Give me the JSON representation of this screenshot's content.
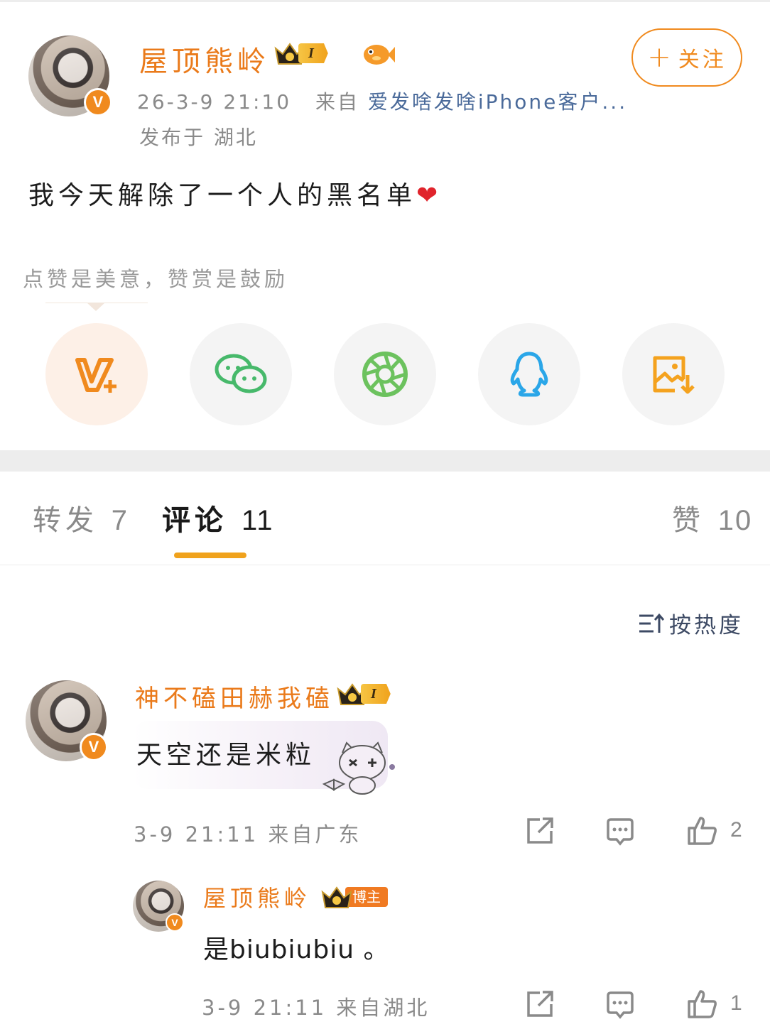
{
  "post": {
    "author_name": "屋顶熊岭",
    "member_level": "I",
    "timestamp": "26-3-9 21:10",
    "source_prefix": "来自",
    "source": "爱发啥发啥iPhone客户...",
    "location": "发布于 湖北",
    "follow_label": "关注",
    "content": "我今天解除了一个人的黑名单",
    "heart": "❤"
  },
  "reward_hint": "点赞是美意，赞赏是鼓励",
  "share_icons": [
    "vplus-icon",
    "wechat-icon",
    "moments-icon",
    "qq-icon",
    "save-image-icon"
  ],
  "tabs": {
    "repost_label": "转发",
    "repost_count": "7",
    "comment_label": "评论",
    "comment_count": "11",
    "like_label": "赞",
    "like_count": "10"
  },
  "sort_label": "按热度",
  "comments": [
    {
      "name": "神不磕田赫我磕",
      "member_level": "I",
      "text": "天空还是米粒",
      "meta": "3-9 21:11 来自广东",
      "likes": "2"
    },
    {
      "name": "屋顶熊岭",
      "badge": "博主",
      "text": "是biubiubiu 。",
      "meta": "3-9 21:11 来自湖北",
      "likes": "1"
    }
  ],
  "colors": {
    "accent": "#f08a1e",
    "name": "#ea7a1a",
    "link": "#4a6a9a"
  }
}
